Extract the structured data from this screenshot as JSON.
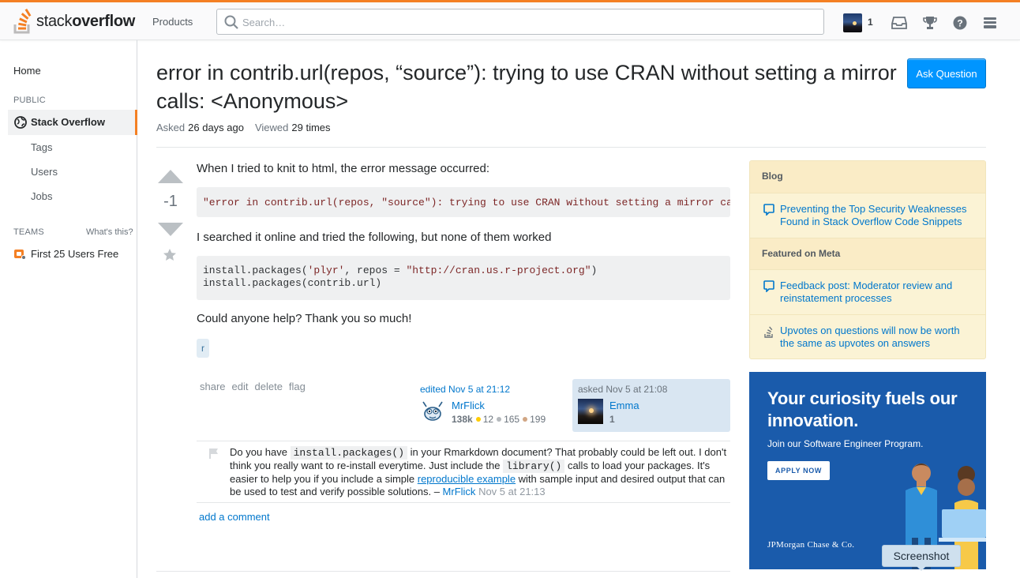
{
  "topbar": {
    "logo_light": "stack",
    "logo_bold": "overflow",
    "products": "Products",
    "search_placeholder": "Search…",
    "reputation": "1"
  },
  "leftnav": {
    "home": "Home",
    "public": "PUBLIC",
    "current": "Stack Overflow",
    "items": [
      "Tags",
      "Users",
      "Jobs"
    ],
    "teams": "TEAMS",
    "whats_this": "What's this?",
    "team_item": "First 25 Users Free"
  },
  "question": {
    "title": "error in contrib.url(repos, “source”): trying to use CRAN without setting a mirror calls: <Anonymous>",
    "ask_button": "Ask Question",
    "asked_label": "Asked",
    "asked_value": "26 days ago",
    "viewed_label": "Viewed",
    "viewed_value": "29 times",
    "votes": "-1",
    "body_p1": "When I tried to knit to html, the error message occurred:",
    "code1": "\"error in contrib.url(repos, \"source\"): trying to use CRAN without setting a mirror calls: <Anonymous>",
    "body_p2": "I searched it online and tried the following, but none of them worked",
    "code2_line1_pre": "install.packages(",
    "code2_line1_s1": "'plyr'",
    "code2_line1_mid": ", repos = ",
    "code2_line1_s2": "\"http://cran.us.r-project.org\"",
    "code2_line1_post": ")",
    "code2_line2": "install.packages(contrib.url)",
    "body_p3": "Could anyone help? Thank you so much!",
    "tag": "r",
    "menu": [
      "share",
      "edit",
      "delete",
      "flag"
    ]
  },
  "editor": {
    "label": "edited Nov 5 at 21:12",
    "name": "MrFlick",
    "rep": "138k",
    "gold": "12",
    "silver": "165",
    "bronze": "199"
  },
  "owner": {
    "label": "asked Nov 5 at 21:08",
    "name": "Emma",
    "rep": "1"
  },
  "comment": {
    "t1": "Do you have ",
    "c1": "install.packages()",
    "t2": " in your Rmarkdown document? That probably could be left out. I don't think you really want to re-install everytime. Just include the ",
    "c2": "library()",
    "t3": " calls to load your packages. It's easier to help you if you include a simple ",
    "link": "reproducible example",
    "t4": " with sample input and desired output that can be used to test and verify possible solutions. – ",
    "user": "MrFlick",
    "date": "Nov 5 at 21:13"
  },
  "add_comment": "add a comment",
  "sidebar": {
    "blog_header": "Blog",
    "blog_item": "Preventing the Top Security Weaknesses Found in Stack Overflow Code Snippets",
    "meta_header": "Featured on Meta",
    "meta_item1": "Feedback post: Moderator review and reinstatement processes",
    "meta_item2": "Upvotes on questions will now be worth the same as upvotes on answers"
  },
  "ad": {
    "headline": "Your curiosity fuels our innovation.",
    "sub": "Join our Software Engineer Program.",
    "button": "APPLY NOW",
    "brand": "JPMorgan Chase & Co."
  },
  "tooltip": "Screenshot",
  "colors": {
    "accent": "#f48024",
    "link": "#0077cc",
    "primary_button": "#0095ff",
    "ad_background": "#1a5bab"
  }
}
